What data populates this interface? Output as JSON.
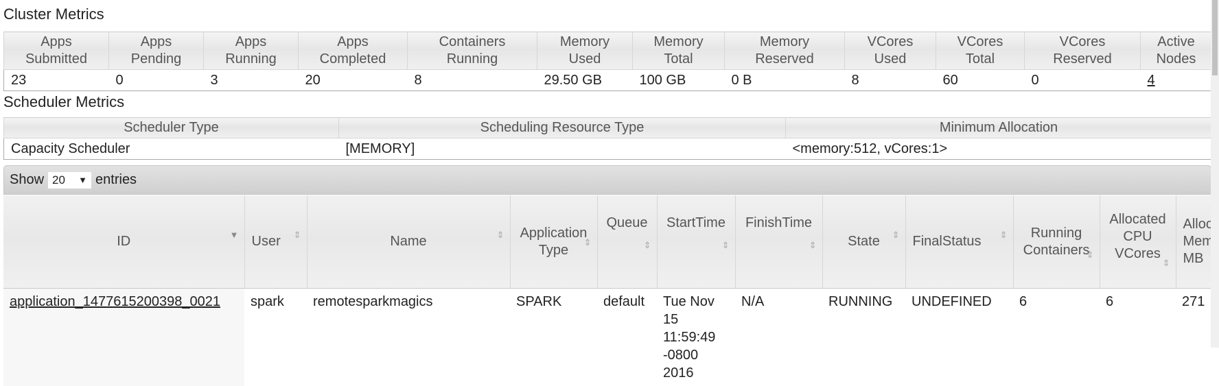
{
  "cluster": {
    "title": "Cluster Metrics",
    "headers": [
      [
        "Apps",
        "Submitted"
      ],
      [
        "Apps",
        "Pending"
      ],
      [
        "Apps",
        "Running"
      ],
      [
        "Apps",
        "Completed"
      ],
      [
        "Containers",
        "Running"
      ],
      [
        "Memory",
        "Used"
      ],
      [
        "Memory",
        "Total"
      ],
      [
        "Memory",
        "Reserved"
      ],
      [
        "VCores",
        "Used"
      ],
      [
        "VCores",
        "Total"
      ],
      [
        "VCores",
        "Reserved"
      ],
      [
        "Active",
        "Nodes"
      ]
    ],
    "values": [
      "23",
      "0",
      "3",
      "20",
      "8",
      "29.50 GB",
      "100 GB",
      "0 B",
      "8",
      "60",
      "0",
      "4"
    ]
  },
  "scheduler": {
    "title": "Scheduler Metrics",
    "headers": [
      "Scheduler Type",
      "Scheduling Resource Type",
      "Minimum Allocation"
    ],
    "values": [
      "Capacity Scheduler",
      "[MEMORY]",
      "<memory:512, vCores:1>"
    ]
  },
  "length": {
    "show_label": "Show",
    "selected": "20",
    "entries_label": "entries",
    "arrow": "▼"
  },
  "apps": {
    "headers": [
      {
        "label": "ID",
        "sort": "▼"
      },
      {
        "label": "User",
        "sort": "⇕"
      },
      {
        "label": "Name",
        "sort": "⇕"
      },
      {
        "label": "Application Type",
        "sort": "⇕"
      },
      {
        "label": "Queue",
        "sort": "⇕"
      },
      {
        "label": "StartTime",
        "sort": "⇕"
      },
      {
        "label": "FinishTime",
        "sort": "⇕"
      },
      {
        "label": "State",
        "sort": "⇕"
      },
      {
        "label": "FinalStatus",
        "sort": "⇕"
      },
      {
        "label": "Running Containers",
        "sort": "⇕"
      },
      {
        "label": "Allocated CPU VCores",
        "sort": "⇕"
      },
      {
        "label": "Allocated Memory MB",
        "sort": ""
      }
    ],
    "rows": [
      {
        "id": "application_1477615200398_0021",
        "user": "spark",
        "name": "remotesparkmagics",
        "type": "SPARK",
        "queue": "default",
        "start": "Tue Nov 15 11:59:49 -0800 2016",
        "finish": "N/A",
        "state": "RUNNING",
        "final_status": "UNDEFINED",
        "running_containers": "6",
        "allocated_vcores": "6",
        "allocated_memory": "271"
      }
    ]
  }
}
